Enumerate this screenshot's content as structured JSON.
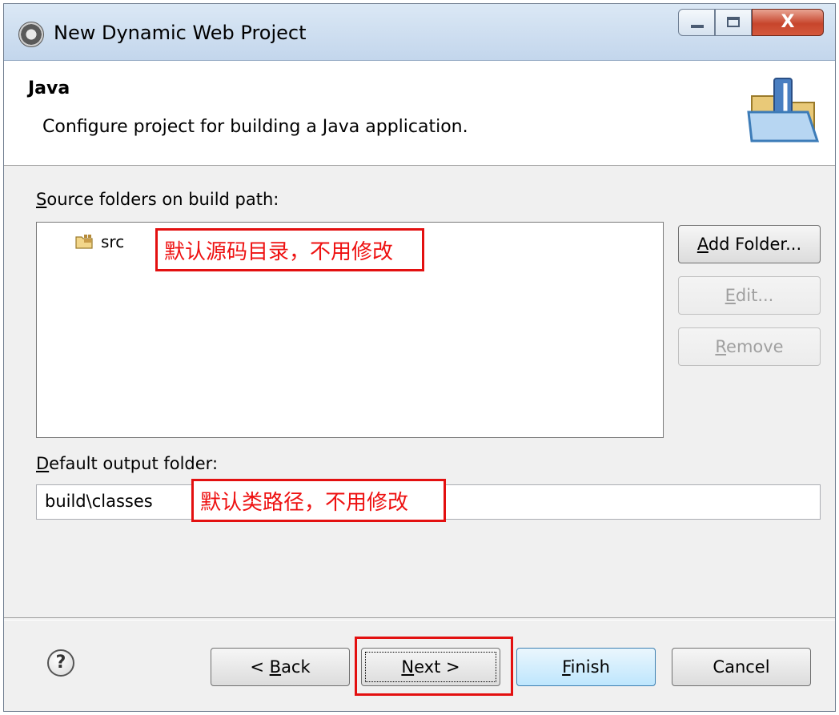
{
  "window": {
    "title": "New Dynamic Web Project",
    "close_glyph": "X"
  },
  "header": {
    "title": "Java",
    "description": "Configure project for building a Java application."
  },
  "source": {
    "label_mnemonic": "S",
    "label_rest": "ource folders on build path:",
    "items": [
      {
        "label": "src"
      }
    ],
    "annotation": "默认源码目录，不用修改"
  },
  "side_buttons": {
    "add_folder_mnemonic": "A",
    "add_folder_rest": "dd Folder...",
    "edit_mnemonic": "E",
    "edit_rest": "dit...",
    "remove_mnemonic": "R",
    "remove_rest": "emove"
  },
  "output": {
    "label_mnemonic": "D",
    "label_rest": "efault output folder:",
    "value": "build\\classes",
    "annotation": "默认类路径，不用修改"
  },
  "footer": {
    "help_glyph": "?",
    "back_prefix": "< ",
    "back_mnemonic": "B",
    "back_rest": "ack",
    "next_mnemonic": "N",
    "next_rest": "ext >",
    "finish_mnemonic": "F",
    "finish_rest": "inish",
    "cancel": "Cancel"
  },
  "icons": {
    "app": "eclipse-icon",
    "banner": "java-folder-icon",
    "source_item": "package-folder-icon",
    "help": "help-icon"
  },
  "colors": {
    "annotation": "#e31010",
    "titlebar": "#c3d6ec",
    "dialog_bg": "#f0f0f0"
  }
}
